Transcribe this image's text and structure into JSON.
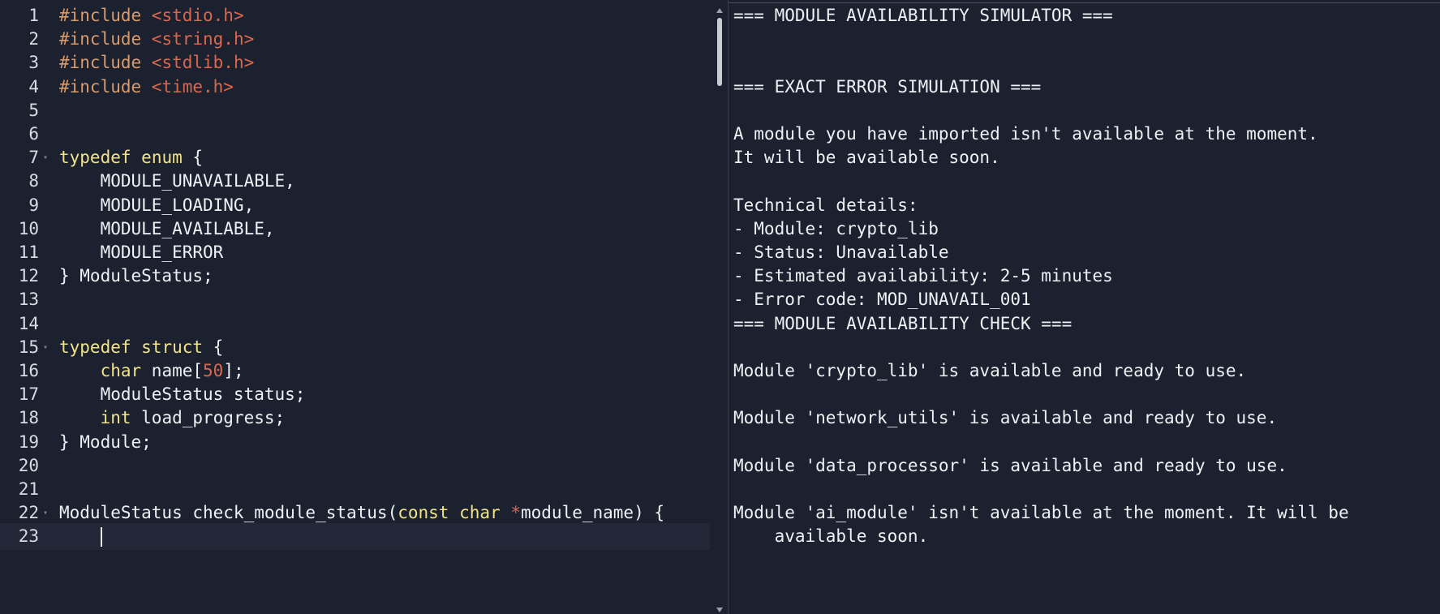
{
  "editor": {
    "lines": [
      {
        "num": "1",
        "tokens": [
          {
            "t": "pp",
            "v": "#include "
          },
          {
            "t": "str",
            "v": "<stdio.h>"
          }
        ]
      },
      {
        "num": "2",
        "tokens": [
          {
            "t": "pp",
            "v": "#include "
          },
          {
            "t": "str",
            "v": "<string.h>"
          }
        ]
      },
      {
        "num": "3",
        "tokens": [
          {
            "t": "pp",
            "v": "#include "
          },
          {
            "t": "str",
            "v": "<stdlib.h>"
          }
        ]
      },
      {
        "num": "4",
        "tokens": [
          {
            "t": "pp",
            "v": "#include "
          },
          {
            "t": "str",
            "v": "<time.h>"
          }
        ]
      },
      {
        "num": "5",
        "tokens": []
      },
      {
        "num": "6",
        "tokens": []
      },
      {
        "num": "7",
        "fold": true,
        "tokens": [
          {
            "t": "kw",
            "v": "typedef"
          },
          {
            "t": "",
            "v": " "
          },
          {
            "t": "kw",
            "v": "enum"
          },
          {
            "t": "",
            "v": " {"
          }
        ]
      },
      {
        "num": "8",
        "tokens": [
          {
            "t": "",
            "v": "    MODULE_UNAVAILABLE,"
          }
        ]
      },
      {
        "num": "9",
        "tokens": [
          {
            "t": "",
            "v": "    MODULE_LOADING,"
          }
        ]
      },
      {
        "num": "10",
        "tokens": [
          {
            "t": "",
            "v": "    MODULE_AVAILABLE,"
          }
        ]
      },
      {
        "num": "11",
        "tokens": [
          {
            "t": "",
            "v": "    MODULE_ERROR"
          }
        ]
      },
      {
        "num": "12",
        "tokens": [
          {
            "t": "",
            "v": "} ModuleStatus;"
          }
        ]
      },
      {
        "num": "13",
        "tokens": []
      },
      {
        "num": "14",
        "tokens": []
      },
      {
        "num": "15",
        "fold": true,
        "tokens": [
          {
            "t": "kw",
            "v": "typedef"
          },
          {
            "t": "",
            "v": " "
          },
          {
            "t": "kw",
            "v": "struct"
          },
          {
            "t": "",
            "v": " {"
          }
        ]
      },
      {
        "num": "16",
        "tokens": [
          {
            "t": "",
            "v": "    "
          },
          {
            "t": "kw",
            "v": "char"
          },
          {
            "t": "",
            "v": " name["
          },
          {
            "t": "num",
            "v": "50"
          },
          {
            "t": "",
            "v": "];"
          }
        ]
      },
      {
        "num": "17",
        "tokens": [
          {
            "t": "",
            "v": "    ModuleStatus status;"
          }
        ]
      },
      {
        "num": "18",
        "tokens": [
          {
            "t": "",
            "v": "    "
          },
          {
            "t": "kw",
            "v": "int"
          },
          {
            "t": "",
            "v": " load_progress;"
          }
        ]
      },
      {
        "num": "19",
        "tokens": [
          {
            "t": "",
            "v": "} Module;"
          }
        ]
      },
      {
        "num": "20",
        "tokens": []
      },
      {
        "num": "21",
        "tokens": []
      },
      {
        "num": "22",
        "fold": true,
        "tokens": [
          {
            "t": "",
            "v": "ModuleStatus check_module_status("
          },
          {
            "t": "kw",
            "v": "const"
          },
          {
            "t": "",
            "v": " "
          },
          {
            "t": "kw",
            "v": "char"
          },
          {
            "t": "",
            "v": " "
          },
          {
            "t": "op",
            "v": "*"
          },
          {
            "t": "",
            "v": "module_name) {"
          }
        ]
      },
      {
        "num": "23",
        "active": true,
        "cursor": true,
        "tokens": [
          {
            "t": "",
            "v": "    "
          }
        ]
      }
    ]
  },
  "output": {
    "lines": [
      "=== MODULE AVAILABILITY SIMULATOR ===",
      "",
      "",
      "=== EXACT ERROR SIMULATION ===",
      "",
      "A module you have imported isn't available at the moment.",
      "It will be available soon.",
      "",
      "Technical details:",
      "- Module: crypto_lib",
      "- Status: Unavailable",
      "- Estimated availability: 2-5 minutes",
      "- Error code: MOD_UNAVAIL_001",
      "=== MODULE AVAILABILITY CHECK ===",
      "",
      "Module 'crypto_lib' is available and ready to use.",
      "",
      "Module 'network_utils' is available and ready to use.",
      "",
      "Module 'data_processor' is available and ready to use.",
      "",
      "Module 'ai_module' isn't available at the moment. It will be",
      "    available soon."
    ]
  },
  "colors": {
    "background": "#1c2130",
    "keyword": "#f1e38a",
    "preprocessor": "#d99a6c",
    "string": "#d9674e",
    "text": "#eef0f4"
  }
}
